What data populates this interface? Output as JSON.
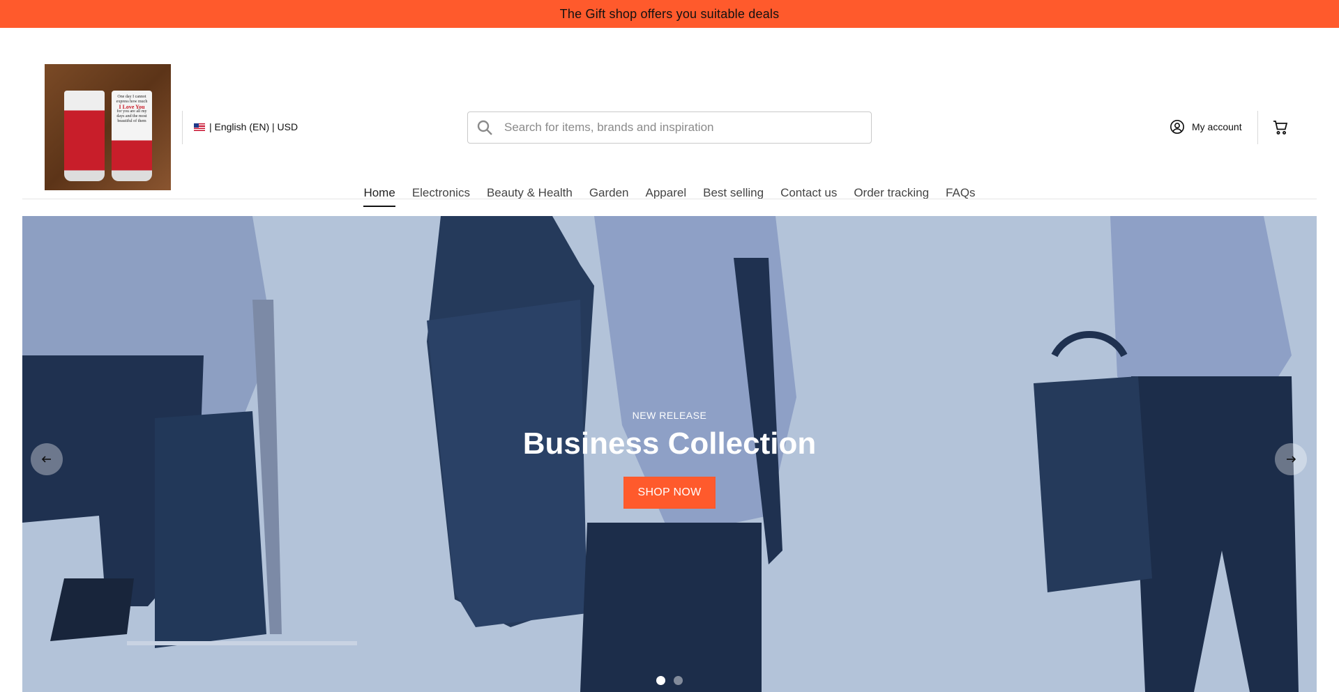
{
  "announcement": {
    "text": "The Gift shop offers you suitable deals"
  },
  "header": {
    "logo_text": {
      "line1": "One day I cannot express how much",
      "emph": "I Love You",
      "line2": "for you are all my days and the most beautiful of them"
    },
    "locale": {
      "flag_icon": "us-flag-icon",
      "label": "| English (EN) | USD"
    },
    "search": {
      "placeholder": "Search for items, brands and inspiration",
      "value": ""
    },
    "account": {
      "label": "My account",
      "icon": "user-circle-icon"
    },
    "cart": {
      "icon": "cart-icon"
    }
  },
  "nav": {
    "items": [
      {
        "label": "Home",
        "active": true
      },
      {
        "label": "Electronics"
      },
      {
        "label": "Beauty & Health"
      },
      {
        "label": "Garden"
      },
      {
        "label": "Apparel"
      },
      {
        "label": "Best selling"
      },
      {
        "label": "Contact us"
      },
      {
        "label": "Order tracking"
      },
      {
        "label": "FAQs"
      }
    ]
  },
  "hero": {
    "tag": "NEW RELEASE",
    "title": "Business Collection",
    "button_label": "SHOP NOW",
    "slides_count": 2,
    "active_slide": 1
  },
  "colors": {
    "accent": "#ff5a2c",
    "hero_bg": "#b3c3d9",
    "hero_dark": "#263d5e"
  }
}
